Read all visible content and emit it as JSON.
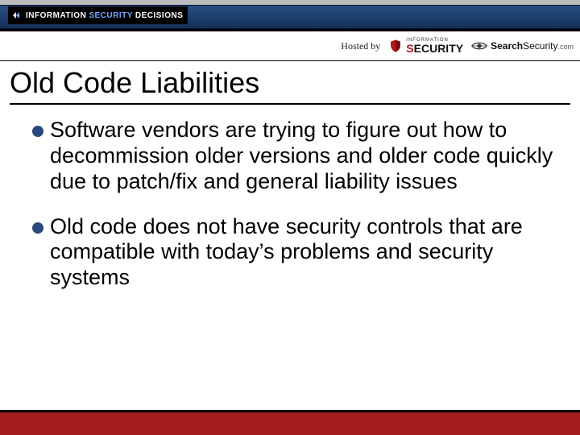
{
  "header": {
    "brand": {
      "w1": "INFORMATION",
      "w2": "SECURITY",
      "w3": "DECISIONS"
    },
    "hosted_by_label": "Hosted by",
    "host1": {
      "tiny": "INFORMATION",
      "big_accent": "S",
      "big_rest": "ECURITY"
    },
    "host2": {
      "bold": "Search",
      "rest": "Security",
      "ext": ".com"
    }
  },
  "title": "Old Code Liabilities",
  "bullets": [
    "Software vendors are trying to figure out how to decommission older versions and older code quickly due to patch/fix and general liability issues",
    "Old code does not have security controls that are compatible with today’s problems and security systems"
  ]
}
